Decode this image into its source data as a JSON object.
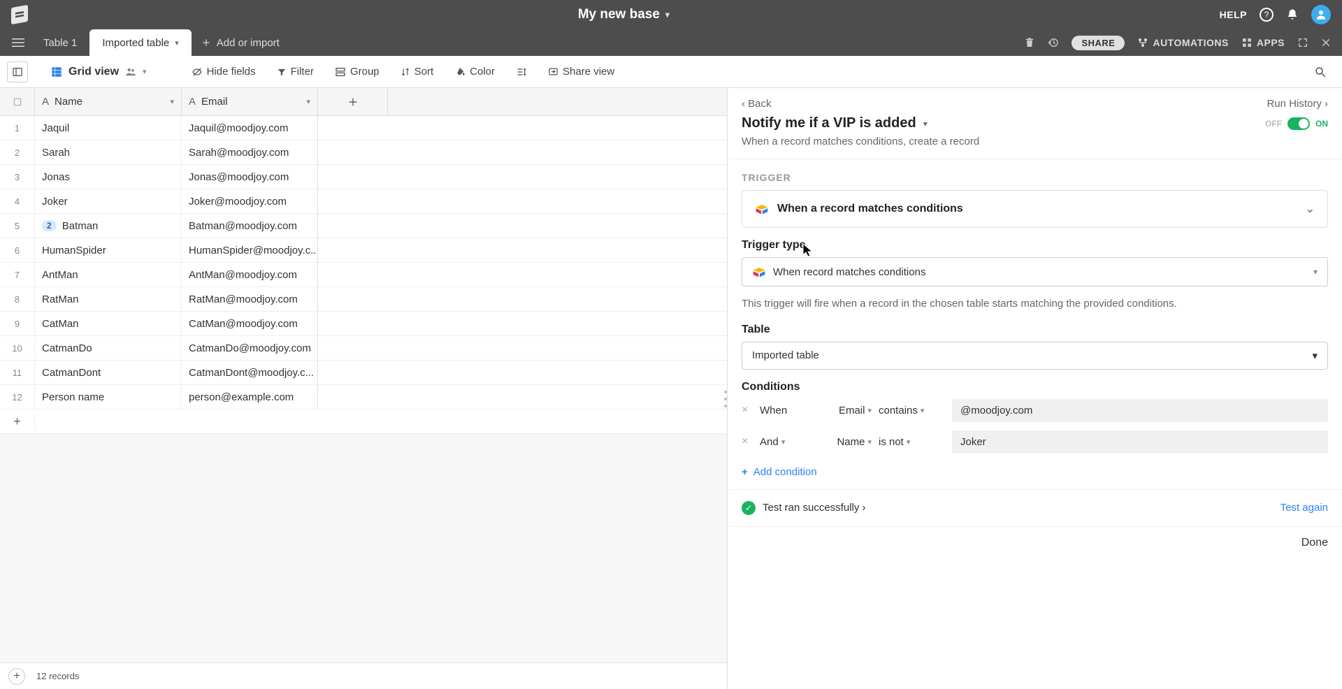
{
  "header": {
    "base_title": "My new base",
    "help": "HELP"
  },
  "tabs": {
    "table1": "Table 1",
    "imported": "Imported table",
    "add_or_import": "Add or import",
    "share": "SHARE",
    "automations": "AUTOMATIONS",
    "apps": "APPS"
  },
  "toolbar": {
    "grid_view": "Grid view",
    "hide_fields": "Hide fields",
    "filter": "Filter",
    "group": "Group",
    "sort": "Sort",
    "color": "Color",
    "share_view": "Share view"
  },
  "columns": {
    "name": "Name",
    "email": "Email"
  },
  "rows": [
    {
      "n": "1",
      "name": "Jaquil",
      "email": "Jaquil@moodjoy.com"
    },
    {
      "n": "2",
      "name": "Sarah",
      "email": "Sarah@moodjoy.com"
    },
    {
      "n": "3",
      "name": "Jonas",
      "email": "Jonas@moodjoy.com"
    },
    {
      "n": "4",
      "name": "Joker",
      "email": "Joker@moodjoy.com"
    },
    {
      "n": "5",
      "name": "Batman",
      "email": "Batman@moodjoy.com",
      "badge": "2"
    },
    {
      "n": "6",
      "name": "HumanSpider",
      "email": "HumanSpider@moodjoy.c..."
    },
    {
      "n": "7",
      "name": "AntMan",
      "email": "AntMan@moodjoy.com"
    },
    {
      "n": "8",
      "name": "RatMan",
      "email": "RatMan@moodjoy.com"
    },
    {
      "n": "9",
      "name": "CatMan",
      "email": "CatMan@moodjoy.com"
    },
    {
      "n": "10",
      "name": "CatmanDo",
      "email": "CatmanDo@moodjoy.com"
    },
    {
      "n": "11",
      "name": "CatmanDont",
      "email": "CatmanDont@moodjoy.c..."
    },
    {
      "n": "12",
      "name": "Person name",
      "email": "person@example.com"
    }
  ],
  "footer": {
    "record_count": "12 records"
  },
  "panel": {
    "back": "Back",
    "run_history": "Run History",
    "title": "Notify me if a VIP is added",
    "off": "OFF",
    "on": "ON",
    "description": "When a record matches conditions, create a record",
    "section_trigger": "TRIGGER",
    "trigger_title": "When a record matches conditions",
    "trigger_type_label": "Trigger type",
    "trigger_type_value": "When record matches conditions",
    "helper": "This trigger will fire when a record in the chosen table starts matching the provided conditions.",
    "table_label": "Table",
    "table_value": "Imported table",
    "conditions_label": "Conditions",
    "conds": [
      {
        "prefix": "When",
        "field": "Email",
        "op": "contains",
        "value": "@moodjoy.com",
        "prefix_drop": false
      },
      {
        "prefix": "And",
        "field": "Name",
        "op": "is not",
        "value": "Joker",
        "prefix_drop": true
      }
    ],
    "add_condition": "Add condition",
    "test_success": "Test ran successfully",
    "test_again": "Test again",
    "done": "Done"
  }
}
